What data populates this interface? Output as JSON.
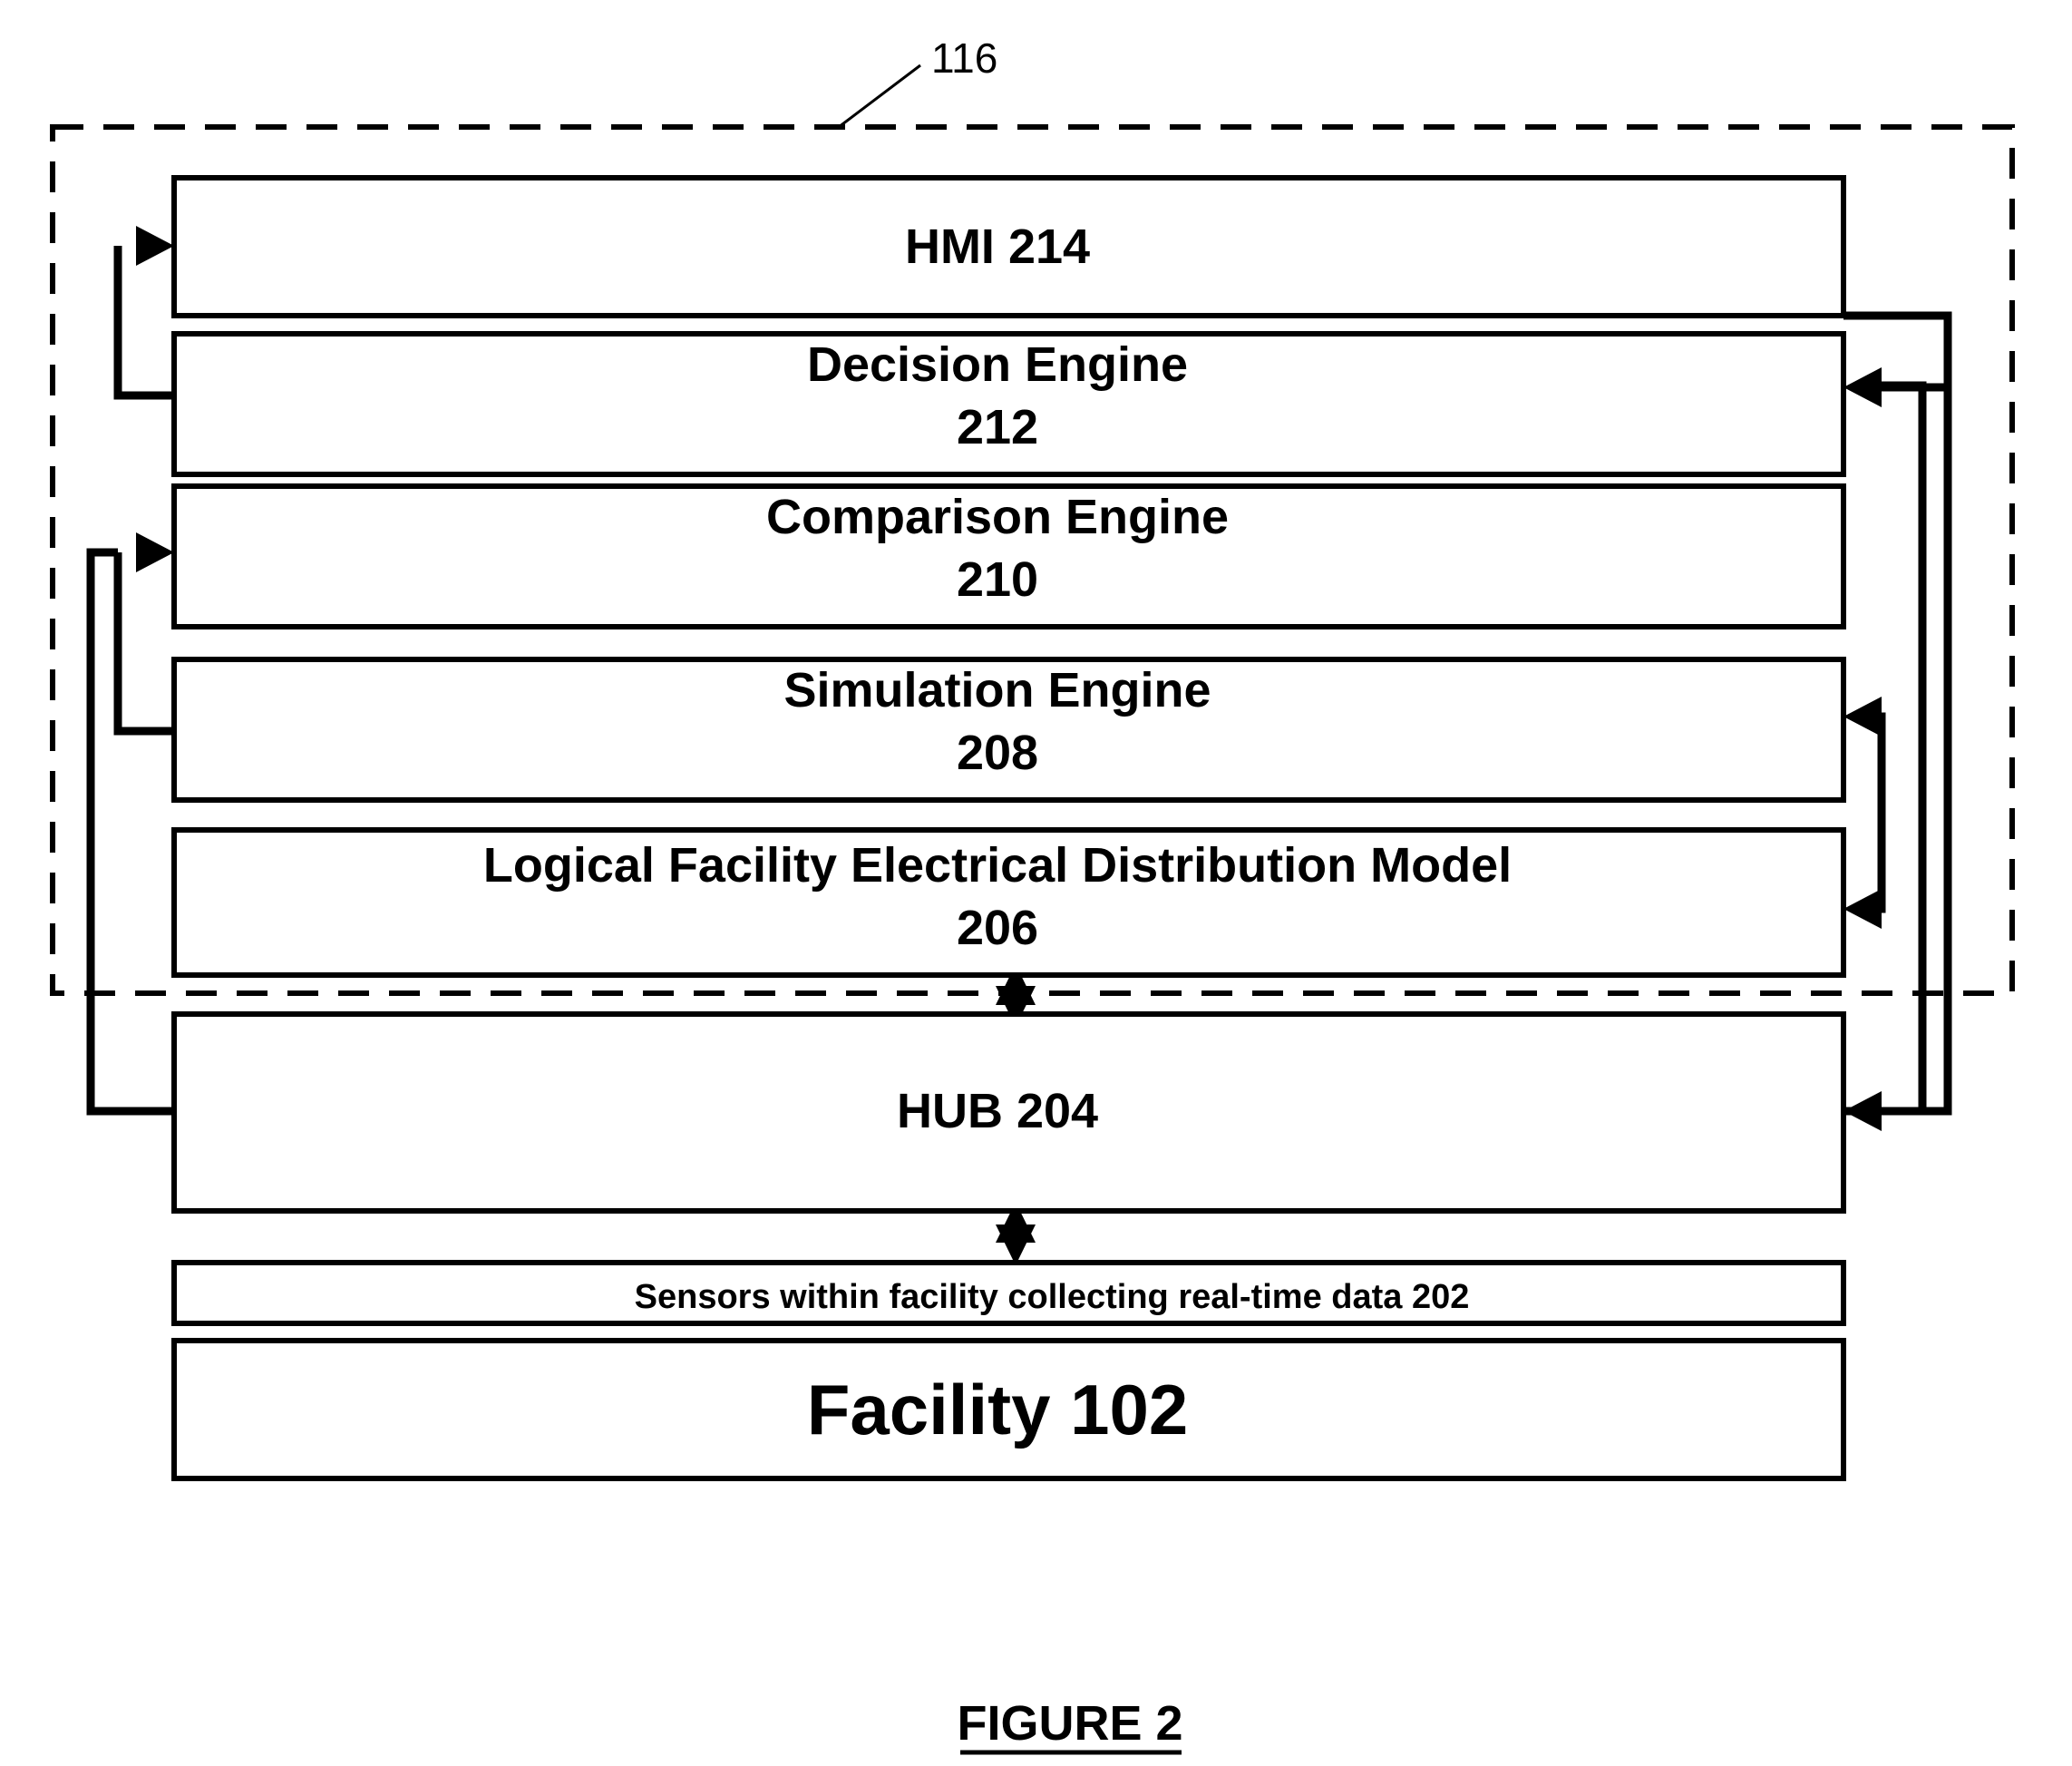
{
  "figure": {
    "caption": "FIGURE 2",
    "system_ref": "116"
  },
  "boundary": {
    "name": "system-boundary-dashed",
    "ref_label": "116"
  },
  "blocks": [
    {
      "id": "hmi",
      "line1": "HMI 214",
      "line2": "",
      "ref": "214",
      "name": "hmi"
    },
    {
      "id": "decision-engine",
      "line1": "Decision Engine",
      "line2": "212",
      "ref": "212",
      "name": "decision-engine"
    },
    {
      "id": "comparison-engine",
      "line1": "Comparison Engine",
      "line2": "210",
      "ref": "210",
      "name": "comparison-engine"
    },
    {
      "id": "simulation-engine",
      "line1": "Simulation Engine",
      "line2": "208",
      "ref": "208",
      "name": "simulation-engine"
    },
    {
      "id": "logical-model",
      "line1": "Logical Facility Electrical Distribution Model",
      "line2": "206",
      "ref": "206",
      "name": "logical-facility-electrical-distribution-model"
    },
    {
      "id": "hub",
      "line1": "HUB 204",
      "line2": "",
      "ref": "204",
      "name": "hub"
    },
    {
      "id": "sensors",
      "line1": "Sensors within facility collecting real-time data 202",
      "line2": "",
      "ref": "202",
      "name": "sensors"
    },
    {
      "id": "facility",
      "line1": "Facility 102",
      "line2": "",
      "ref": "102",
      "name": "facility"
    }
  ],
  "connectors": [
    {
      "name": "decision-engine-to-hmi",
      "kind": "single-arrow",
      "from": "decision-engine",
      "to": "hmi"
    },
    {
      "name": "simulation-engine-to-comparison-engine",
      "kind": "single-arrow",
      "from": "simulation-engine",
      "to": "comparison-engine"
    },
    {
      "name": "comparison-engine-to-hub",
      "kind": "single-arrow",
      "from": "comparison-engine",
      "to": "hub"
    },
    {
      "name": "hmi-to-decision-engine",
      "kind": "single-arrow",
      "from": "hmi",
      "to": "decision-engine"
    },
    {
      "name": "simulation-engine-logical-model-bidirectional",
      "kind": "double-arrow",
      "from": "simulation-engine",
      "to": "logical-model"
    },
    {
      "name": "comparison-engine-to-hub-right",
      "kind": "single-arrow",
      "from": "comparison-engine",
      "to": "hub"
    },
    {
      "name": "logical-model-to-hub-vertical",
      "kind": "double-arrow",
      "from": "logical-model",
      "to": "hub"
    },
    {
      "name": "hub-to-sensors-vertical",
      "kind": "double-arrow",
      "from": "hub",
      "to": "sensors"
    }
  ],
  "colors": {
    "stroke": "#000000",
    "fill": "#ffffff",
    "background": "#ffffff"
  }
}
